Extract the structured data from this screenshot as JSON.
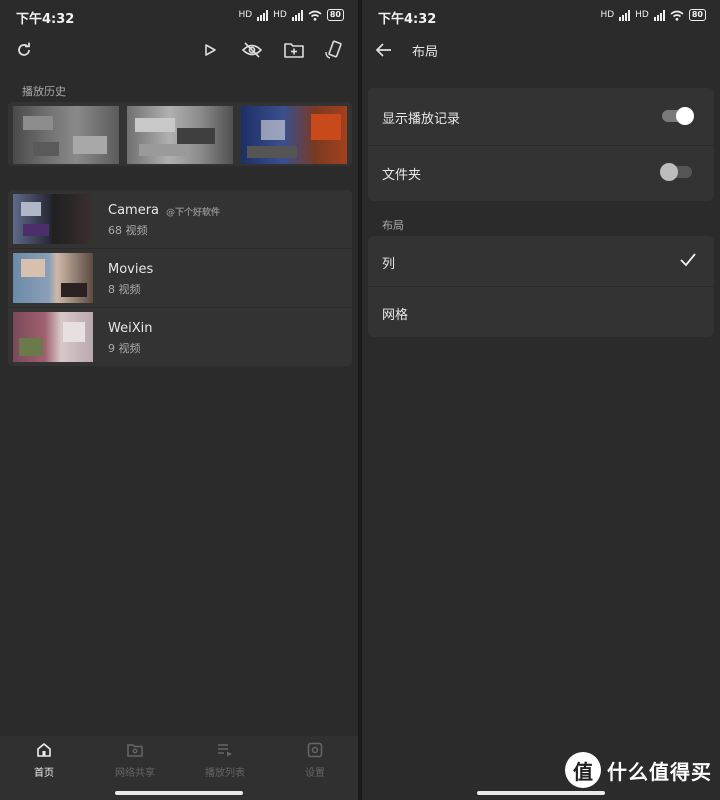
{
  "status": {
    "time": "下午4:32",
    "net1": "HD",
    "net2": "HD",
    "battery": "80"
  },
  "left": {
    "history_label": "播放历史",
    "folders": [
      {
        "name": "Camera",
        "count": "68 视频",
        "watermark": "@下个好软件"
      },
      {
        "name": "Movies",
        "count": "8 视频"
      },
      {
        "name": "WeiXin",
        "count": "9 视频"
      }
    ],
    "nav": [
      {
        "label": "首页",
        "icon": "home-icon"
      },
      {
        "label": "网络共享",
        "icon": "folder-network-icon"
      },
      {
        "label": "播放列表",
        "icon": "playlist-icon"
      },
      {
        "label": "设置",
        "icon": "settings-icon"
      }
    ]
  },
  "right": {
    "title": "布局",
    "show_history_label": "显示播放记录",
    "show_history_on": true,
    "folder_label": "文件夹",
    "folder_on": false,
    "layout_section_label": "布局",
    "option_list": "列",
    "option_grid": "网格",
    "selected_option": "列"
  },
  "watermark": {
    "text": "什么值得买",
    "logo_char": "值"
  },
  "colors": {
    "switch_on_knob": "#ffffff",
    "switch_off_knob": "#bdbdbd"
  }
}
